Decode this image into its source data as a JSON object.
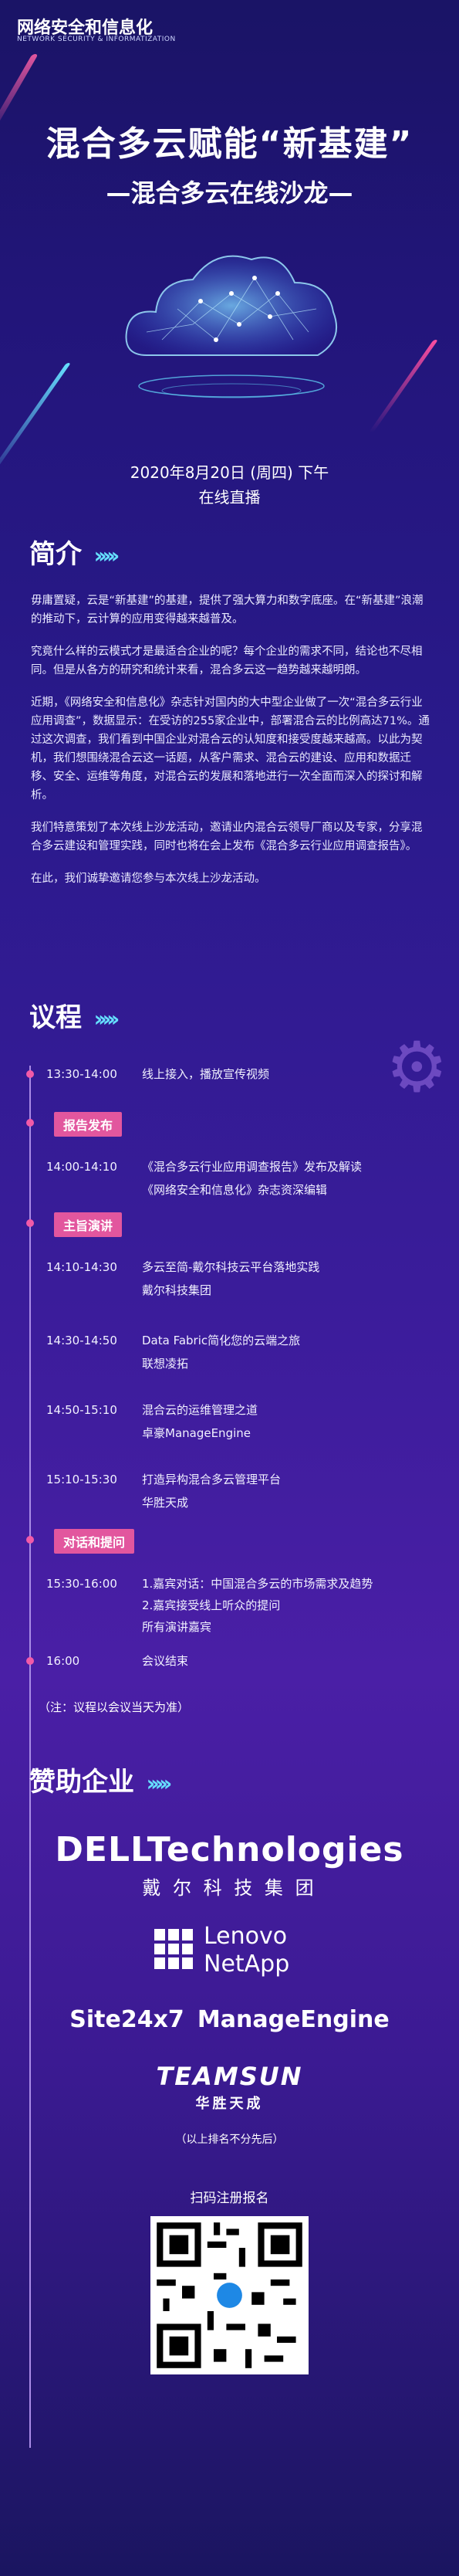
{
  "logo": {
    "text": "网络安全和信息化",
    "subtitle": "NETWORK SECURITY & INFORMATIZATION"
  },
  "hero": {
    "title": "混合多云赋能“新基建”",
    "subtitle": "—混合多云在线沙龙—",
    "date": "2020年8月20日 (周四) 下午",
    "mode": "在线直播"
  },
  "intro": {
    "heading": "简介",
    "paragraphs": [
      "毋庸置疑，云是“新基建”的基建，提供了强大算力和数字底座。在“新基建”浪潮的推动下，云计算的应用变得越来越普及。",
      "究竟什么样的云模式才是最适合企业的呢？每个企业的需求不同，结论也不尽相同。但是从各方的研究和统计来看，混合多云这一趋势越来越明朗。",
      "近期，《网络安全和信息化》杂志针对国内的大中型企业做了一次“混合多云行业应用调查”，数据显示：在受访的255家企业中，部署混合云的比例高达71%。通过这次调查，我们看到中国企业对混合云的认知度和接受度越来越高。以此为契机，我们想围绕混合云这一话题，从客户需求、混合云的建设、应用和数据迁移、安全、运维等角度，对混合云的发展和落地进行一次全面而深入的探讨和解析。",
      "我们特意策划了本次线上沙龙活动，邀请业内混合云领导厂商以及专家，分享混合多云建设和管理实践，同时也将在会上发布《混合多云行业应用调查报告》。",
      "在此，我们诚挚邀请您参与本次线上沙龙活动。"
    ]
  },
  "agenda": {
    "heading": "议程",
    "tags": {
      "report": "报告发布",
      "keynote": "主旨演讲",
      "dialogue": "对话和提问"
    },
    "items": [
      {
        "time": "13:30-14:00",
        "line1": "线上接入，播放宣传视频",
        "line2": ""
      },
      {
        "time": "14:00-14:10",
        "line1": "《混合多云行业应用调查报告》发布及解读",
        "line2": "《网络安全和信息化》杂志资深编辑"
      },
      {
        "time": "14:10-14:30",
        "line1": "多云至简-戴尔科技云平台落地实践",
        "line2": "戴尔科技集团"
      },
      {
        "time": "14:30-14:50",
        "line1": "Data Fabric简化您的云端之旅",
        "line2": "联想凌拓"
      },
      {
        "time": "14:50-15:10",
        "line1": "混合云的运维管理之道",
        "line2": "卓豪ManageEngine"
      },
      {
        "time": "15:10-15:30",
        "line1": "打造异构混合多云管理平台",
        "line2": "华胜天成"
      },
      {
        "time": "15:30-16:00",
        "line1": "1.嘉宾对话：中国混合多云的市场需求及趋势",
        "line2": "2.嘉宾接受线上听众的提问",
        "line3": "所有演讲嘉宾"
      },
      {
        "time": "16:00",
        "line1": "会议结束",
        "line2": ""
      }
    ],
    "note": "（注：议程以会议当天为准）"
  },
  "sponsors": {
    "heading": "赞助企业",
    "dell": "DELLTechnologies",
    "dell_cn": "戴 尔 科 技 集 团",
    "lenovo": "Lenovo",
    "netapp": "NetApp",
    "site24x7": "Site24x7",
    "manageengine": "ManageEngine",
    "teamsun": "TEAMSUN",
    "teamsun_cn": "华胜天成",
    "order_note": "（以上排名不分先后）"
  },
  "register": {
    "label": "扫码注册报名"
  },
  "colors": {
    "accent": "#e2569e",
    "cyan": "#66e0ff"
  }
}
